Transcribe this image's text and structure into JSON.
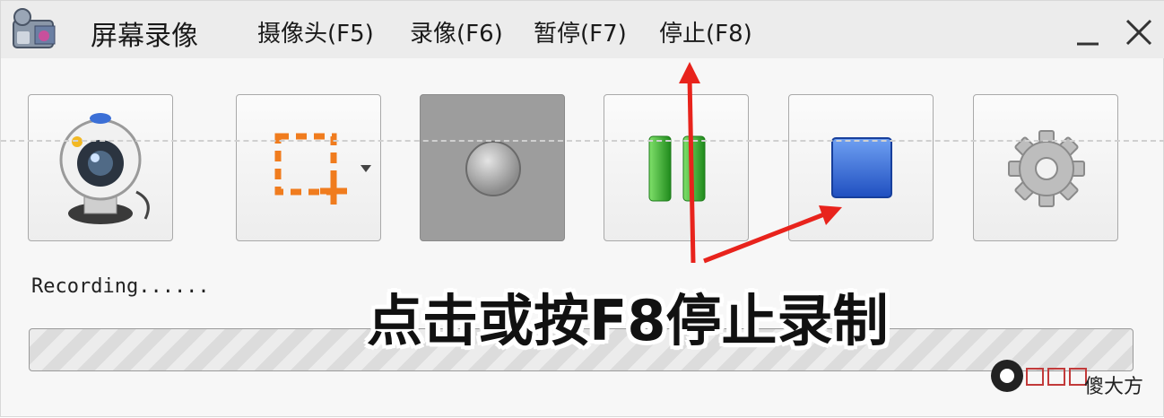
{
  "window": {
    "title": "屏幕录像",
    "menu": [
      {
        "label": "摄像头(F5)"
      },
      {
        "label": "录像(F6)"
      },
      {
        "label": "暂停(F7)"
      },
      {
        "label": "停止(F8)"
      }
    ]
  },
  "toolbar": {
    "buttons": [
      {
        "name": "webcam-button"
      },
      {
        "name": "region-select-button"
      },
      {
        "name": "record-button",
        "state": "active"
      },
      {
        "name": "pause-button"
      },
      {
        "name": "stop-button"
      },
      {
        "name": "settings-button"
      }
    ]
  },
  "status": {
    "text": "Recording......"
  },
  "progress": {
    "value": 0
  },
  "annotation": {
    "text": "点击或按F8停止录制",
    "arrow_color": "#e8231c"
  },
  "watermark": {
    "text": "傻大方"
  },
  "colors": {
    "record_bg": "#9d9d9d",
    "pause_green": "#2fa12a",
    "stop_blue": "#2a5fd0",
    "region_orange": "#f07c1e"
  }
}
